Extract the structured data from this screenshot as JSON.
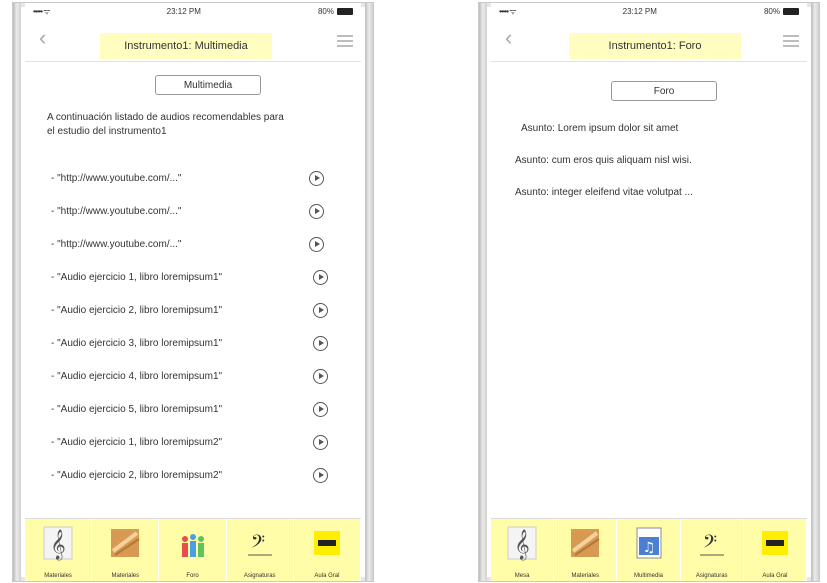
{
  "left": {
    "status": {
      "signal": "••••• ᯤ",
      "time": "23:12 PM",
      "battery": "80%"
    },
    "nav": {
      "back_glyph": "‹",
      "title": "Instrumento1: Multimedia"
    },
    "section_button": "Multimedia",
    "intro": "A continuación listado de audios recomendables para el estudio del instrumento1",
    "items": [
      "- \"http://www.youtube.com/...\"",
      "- \"http://www.youtube.com/...\"",
      "- \"http://www.youtube.com/...\"",
      "- \"Audio ejercicio 1, libro loremipsum1\"",
      "- \"Audio ejercicio 2, libro loremipsum1\"",
      "- \"Audio ejercicio 3, libro loremipsum1\"",
      "- \"Audio ejercicio 4, libro loremipsum1\"",
      "- \"Audio ejercicio 5, libro loremipsum1\"",
      "- \"Audio ejercicio 1, libro loremipsum2\"",
      "- \"Audio ejercicio 2, libro loremipsum2\""
    ],
    "tabs": [
      {
        "label": "Materiales",
        "icon": "treble-clef-icon"
      },
      {
        "label": "Materiales",
        "icon": "sheet-music-icon"
      },
      {
        "label": "Foro",
        "icon": "people-icon"
      },
      {
        "label": "Asignaturas",
        "icon": "clef-icon"
      },
      {
        "label": "Aula Gral",
        "icon": "logo-icon"
      }
    ]
  },
  "right": {
    "status": {
      "signal": "••••• ᯤ",
      "time": "23:12 PM",
      "battery": "80%"
    },
    "nav": {
      "back_glyph": "‹",
      "title": "Instrumento1: Foro"
    },
    "section_button": "Foro",
    "subjects": [
      "Asunto: Lorem ipsum dolor sit amet",
      "Asunto: cum eros quis aliquam nisl wisi.",
      "Asunto: integer eleifend vitae volutpat ..."
    ],
    "tabs": [
      {
        "label": "Mesa",
        "icon": "treble-clef-icon"
      },
      {
        "label": "Materiales",
        "icon": "sheet-music-icon"
      },
      {
        "label": "Multimedia",
        "icon": "music-file-icon"
      },
      {
        "label": "Asignaturas",
        "icon": "clef-icon"
      },
      {
        "label": "Aula Gral",
        "icon": "logo-icon"
      }
    ]
  },
  "colors": {
    "title_bg": "#fffdbf",
    "tabbar_bg": "#fffda8",
    "logo": "#ffee00"
  }
}
